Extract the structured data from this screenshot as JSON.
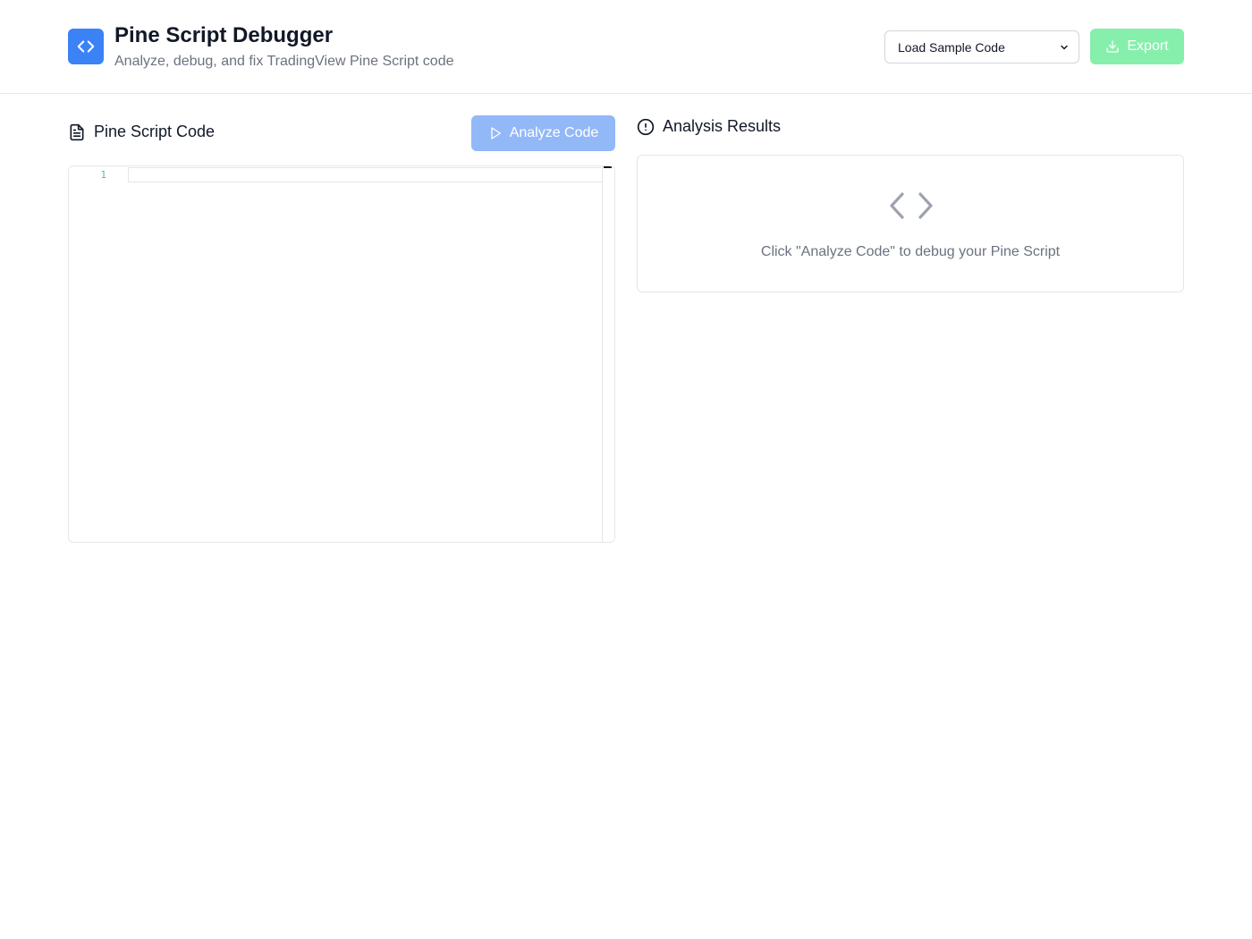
{
  "header": {
    "title": "Pine Script Debugger",
    "subtitle": "Analyze, debug, and fix TradingView Pine Script code",
    "logo_icon": "code-brackets-icon",
    "sample_select": {
      "selected": "Load Sample Code"
    },
    "export_label": "Export"
  },
  "editor_panel": {
    "title": "Pine Script Code",
    "title_icon": "file-text-icon",
    "analyze_label": "Analyze Code",
    "line_numbers": [
      "1"
    ]
  },
  "results_panel": {
    "title": "Analysis Results",
    "title_icon": "alert-circle-icon",
    "empty_icon": "code-brackets-icon",
    "empty_message": "Click \"Analyze Code\" to debug your Pine Script"
  },
  "colors": {
    "primary": "#3b82f6",
    "analyze_button": "#93b8f8",
    "export_button": "#86efac",
    "muted_text": "#6b7280",
    "border": "#e5e7eb"
  }
}
